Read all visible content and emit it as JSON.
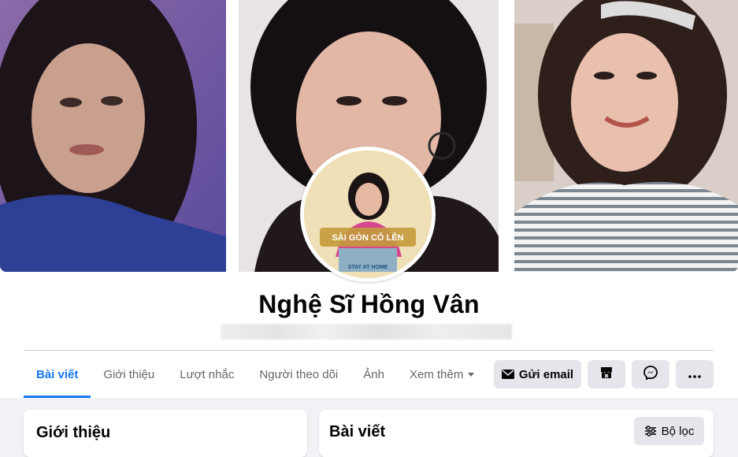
{
  "profile": {
    "name": "Nghệ Sĩ Hồng Vân",
    "avatar_badge_text": "SÀI GÒN CỐ LÊN",
    "avatar_sub_text": "STAY AT HOME"
  },
  "tabs": [
    {
      "label": "Bài viết",
      "active": true
    },
    {
      "label": "Giới thiệu",
      "active": false
    },
    {
      "label": "Lượt nhắc",
      "active": false
    },
    {
      "label": "Người theo dõi",
      "active": false
    },
    {
      "label": "Ảnh",
      "active": false
    },
    {
      "label": "Xem thêm",
      "active": false
    }
  ],
  "actions": {
    "email_label": "Gửi email",
    "shop_icon": "shop-icon",
    "messenger_icon": "messenger-icon",
    "more_icon": "more-icon"
  },
  "cards": {
    "intro_title": "Giới thiệu",
    "posts_title": "Bài viết",
    "filter_label": "Bộ lọc"
  },
  "colors": {
    "accent": "#1877f2",
    "page_bg": "#f0f2f5",
    "button_bg": "#e4e6eb"
  }
}
